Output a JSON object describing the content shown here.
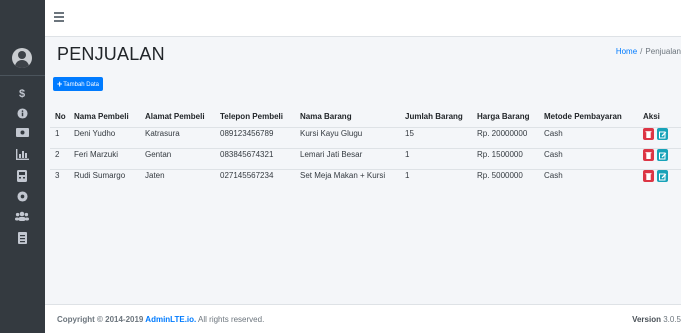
{
  "sidebar": {
    "icons": [
      "user-avatar",
      "dollar-icon",
      "info-circle-icon",
      "money-bill-icon",
      "chart-icon",
      "calculator-icon",
      "circle-icon",
      "users-icon",
      "file-icon"
    ],
    "dollar_glyph": "$"
  },
  "header": {
    "page_title": "PENJUALAN",
    "breadcrumb_home": "Home",
    "breadcrumb_separator": "/",
    "breadcrumb_current": "Penjualan"
  },
  "toolbar": {
    "add_label": "Tambah Data",
    "add_icon": "+"
  },
  "table": {
    "columns": [
      "No",
      "Nama Pembeli",
      "Alamat Pembeli",
      "Telepon Pembeli",
      "Nama Barang",
      "Jumlah Barang",
      "Harga Barang",
      "Metode Pembayaran",
      "Aksi"
    ],
    "rows": [
      [
        "1",
        "Deni Yudho",
        "Katrasura",
        "089123456789",
        "Kursi Kayu Glugu",
        "15",
        "Rp. 20000000",
        "Cash"
      ],
      [
        "2",
        "Feri Marzuki",
        "Gentan",
        "083845674321",
        "Lemari Jati Besar",
        "1",
        "Rp. 1500000",
        "Cash"
      ],
      [
        "3",
        "Rudi Sumargo",
        "Jaten",
        "027145567234",
        "Set Meja Makan + Kursi",
        "1",
        "Rp. 5000000",
        "Cash"
      ]
    ]
  },
  "footer": {
    "copyright_prefix": "Copyright © 2014-2019 ",
    "copyright_link": "AdminLTE.io.",
    "copyright_suffix": " All rights reserved.",
    "version_label": "Version",
    "version_value": " 3.0.5"
  },
  "colors": {
    "accent": "#007bff",
    "danger": "#dc3545",
    "info": "#17a2b8",
    "sidebar": "#343a40"
  }
}
